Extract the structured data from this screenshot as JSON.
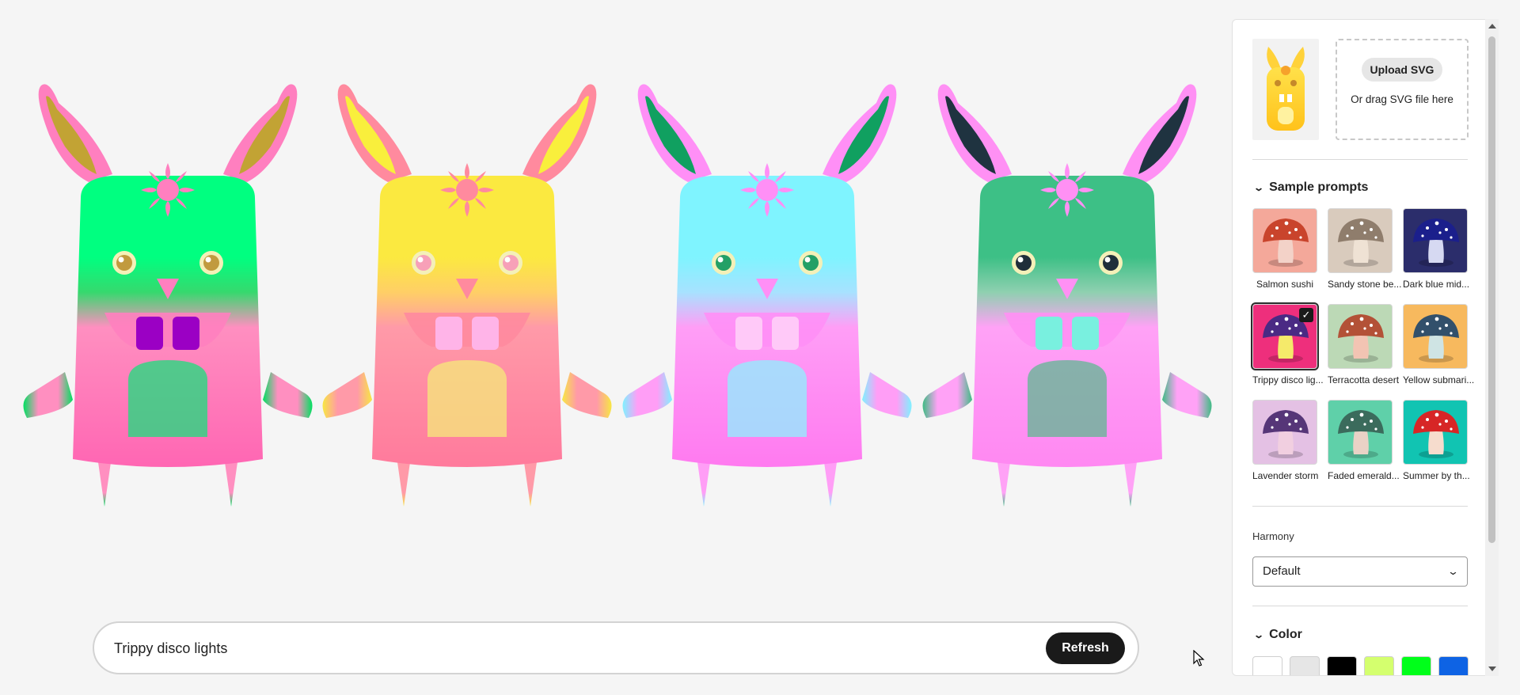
{
  "prompt": {
    "value": "Trippy disco lights",
    "refresh_label": "Refresh"
  },
  "upload": {
    "button_label": "Upload SVG",
    "hint": "Or drag SVG file here"
  },
  "sample_prompts": {
    "title": "Sample prompts",
    "items": [
      {
        "label": "Salmon sushi",
        "bg": "#f4a89a",
        "cap": "#c9442c",
        "stem": "#f3d2c8",
        "selected": false
      },
      {
        "label": "Sandy stone be...",
        "bg": "#d9cbbd",
        "cap": "#8f7d6c",
        "stem": "#efe2d4",
        "selected": false
      },
      {
        "label": "Dark blue mid...",
        "bg": "#2b2d6b",
        "cap": "#1b1f8c",
        "stem": "#d6d9f2",
        "selected": false
      },
      {
        "label": "Trippy disco lig...",
        "bg": "#ee2f7c",
        "cap": "#4a2a84",
        "stem": "#f5ea6a",
        "selected": true
      },
      {
        "label": "Terracotta desert",
        "bg": "#bcd9b6",
        "cap": "#b35137",
        "stem": "#f2c4b3",
        "selected": false
      },
      {
        "label": "Yellow submari...",
        "bg": "#f7b95e",
        "cap": "#32506b",
        "stem": "#cfe4e4",
        "selected": false
      },
      {
        "label": "Lavender storm",
        "bg": "#e4c1e4",
        "cap": "#563678",
        "stem": "#f1cfe0",
        "selected": false
      },
      {
        "label": "Faded emerald...",
        "bg": "#5fd0a9",
        "cap": "#3b6b5c",
        "stem": "#e9d2c6",
        "selected": false
      },
      {
        "label": "Summer by th...",
        "bg": "#11c4b2",
        "cap": "#d72626",
        "stem": "#f6dccd",
        "selected": false
      }
    ]
  },
  "harmony": {
    "label": "Harmony",
    "value": "Default"
  },
  "color": {
    "title": "Color",
    "chips": [
      "#ffffff",
      "#e6e6e6",
      "#000000",
      "#d4ff6e",
      "#00ff1a",
      "#0e63e4"
    ]
  },
  "bunnies": [
    {
      "name": "variant-1",
      "body_top": "#00ff80",
      "band": "#36d96e",
      "body": "#ff8fc0",
      "body_low": "#ff66b3",
      "ear": "#ff7fbf",
      "inner_ear": "#c2a334",
      "eye": "#c19a3e",
      "teeth": "#9b00c4",
      "belly": "#18e07c",
      "tip": "#00e060"
    },
    {
      "name": "variant-2",
      "body_top": "#fbe940",
      "band": "#ffcf66",
      "body": "#ff9aa8",
      "body_low": "#ff7a9c",
      "ear": "#ff8a9e",
      "inner_ear": "#f9ef3c",
      "eye": "#f7a0b8",
      "teeth": "#ffb4e8",
      "belly": "#f6e97a",
      "tip": "#f7e743"
    },
    {
      "name": "variant-3",
      "body_top": "#7ff4ff",
      "band": "#a7e2ff",
      "body": "#ff9ef6",
      "body_low": "#ff7af0",
      "ear": "#ff8ff6",
      "inner_ear": "#10a060",
      "eye": "#23a066",
      "teeth": "#ffc9f8",
      "belly": "#8ef2ff",
      "tip": "#7ff1ff"
    },
    {
      "name": "variant-4",
      "body_top": "#3dc086",
      "band": "#8fd0b0",
      "body": "#ffa2f6",
      "body_low": "#ff88f2",
      "ear": "#ff90f4",
      "inner_ear": "#1f3340",
      "eye": "#1f2e3a",
      "teeth": "#79f0df",
      "belly": "#5fb891",
      "tip": "#3ebc84"
    }
  ]
}
